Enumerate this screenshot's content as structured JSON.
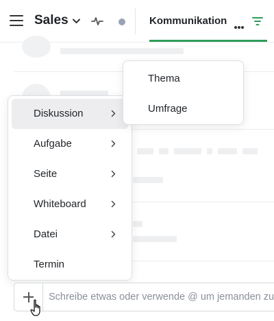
{
  "header": {
    "menu_icon": "hamburger-icon",
    "channel_name": "Sales",
    "channel_dropdown_icon": "chevron-down-icon",
    "activity_icon": "pulse-icon",
    "status_color": "#9aa3b5",
    "active_tab": "Kommunikation",
    "tab_accent_color": "#2e9c59",
    "more_icon": "more-horizontal-icon",
    "filter_icon": "filter-icon"
  },
  "create_menu": {
    "items": [
      {
        "label": "Diskussion",
        "has_submenu": true,
        "highlighted": true
      },
      {
        "label": "Aufgabe",
        "has_submenu": true,
        "highlighted": false
      },
      {
        "label": "Seite",
        "has_submenu": true,
        "highlighted": false
      },
      {
        "label": "Whiteboard",
        "has_submenu": true,
        "highlighted": false
      },
      {
        "label": "Datei",
        "has_submenu": true,
        "highlighted": false
      },
      {
        "label": "Termin",
        "has_submenu": false,
        "highlighted": false
      }
    ]
  },
  "submenu": {
    "items": [
      {
        "label": "Thema"
      },
      {
        "label": "Umfrage"
      }
    ]
  },
  "composer": {
    "add_icon": "plus-icon",
    "placeholder": "Schreibe etwas oder verwende @ um jemanden zu erwähnen"
  },
  "pointer": "hand-pointer-icon"
}
